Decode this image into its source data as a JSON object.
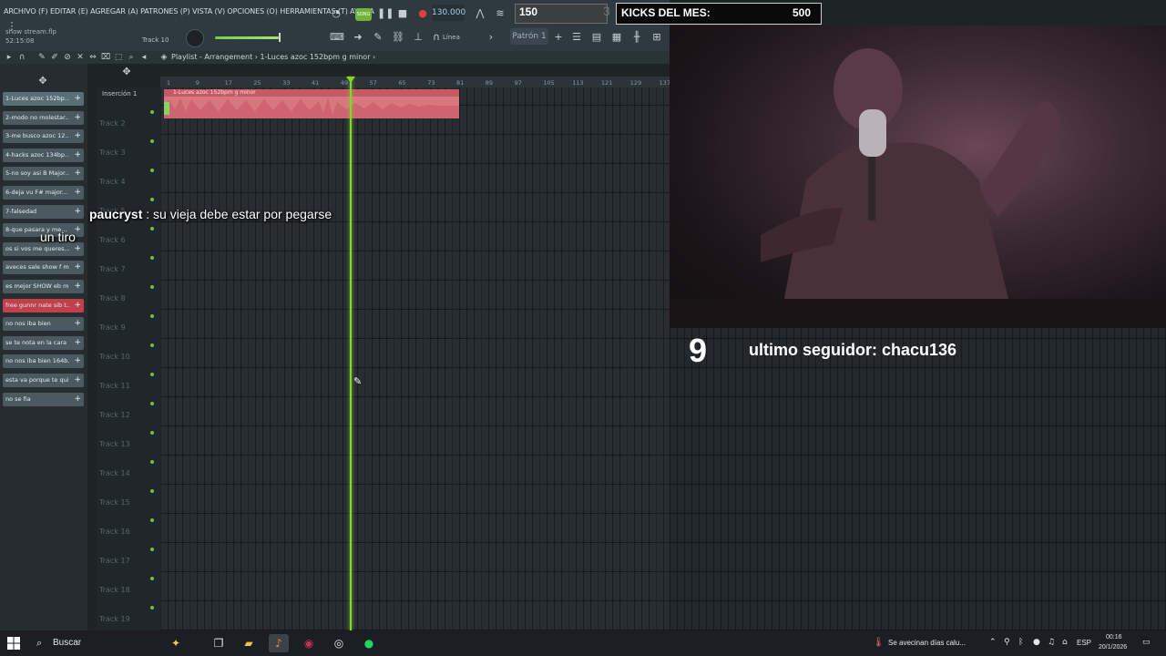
{
  "menu": "ARCHIVO (F) EDITAR (E) AGREGAR (A) PATRONES (P) VISTA (V) OPCIONES (O) HERRAMIENTAS (T) AYUDA",
  "project": {
    "name": "show stream.flp",
    "time": "52:15:08"
  },
  "transport": {
    "song_badge": "SONG",
    "tempo": "130.000"
  },
  "mixer_track": "Track 10",
  "line_mode": "Línea",
  "pattern": "Patrón 1",
  "hud": {
    "counter": "150",
    "ghost": "3",
    "kicks_label": "KICKS DEL MES:",
    "kicks_value": "500"
  },
  "breadcrumb": "Playlist - Arrangement  ›  1-Luces azoc 152bpm g minor  ›",
  "insert_label": "Inserción 1",
  "clip": {
    "title": "1-Luces azoc 152bpm g minor"
  },
  "ruler": [
    "1",
    "9",
    "17",
    "25",
    "33",
    "41",
    "49",
    "57",
    "65",
    "73",
    "81",
    "89",
    "97",
    "105",
    "113",
    "121",
    "129",
    "137"
  ],
  "tracks": [
    "Track 2",
    "Track 3",
    "Track 4",
    "Track 5",
    "Track 6",
    "Track 7",
    "Track 8",
    "Track 9",
    "Track 10",
    "Track 11",
    "Track 12",
    "Track 13",
    "Track 14",
    "Track 15",
    "Track 16",
    "Track 17",
    "Track 18",
    "Track 19"
  ],
  "channels": [
    {
      "label": "1-Luces azoc 152bp...",
      "color": "#5a6e77"
    },
    {
      "label": "2-modo no molestar...",
      "color": "#4b5a61"
    },
    {
      "label": "3-me busco azoc 12...",
      "color": "#4b5a61"
    },
    {
      "label": "4-hacks azoc 134bp...",
      "color": "#4b5a61"
    },
    {
      "label": "5-no soy asi  B Major...",
      "color": "#4b5a61"
    },
    {
      "label": "6-deja vu  F# major...",
      "color": "#4b5a61"
    },
    {
      "label": "7-falsedad",
      "color": "#4b5a61"
    },
    {
      "label": "8-que pasara y me...",
      "color": "#4b5a61"
    },
    {
      "label": "os si vos me queres...",
      "color": "#4b5a61"
    },
    {
      "label": "aveces sale show f m...",
      "color": "#4b5a61"
    },
    {
      "label": "es mejor SHOW eb mi...",
      "color": "#4b5a61"
    },
    {
      "label": "free gunnr  nate sib t...",
      "color": "#c0404c"
    },
    {
      "label": "no nos iba bien",
      "color": "#4b5a61"
    },
    {
      "label": "se te nota en la cara",
      "color": "#4b5a61"
    },
    {
      "label": "no nos iba bien 164b...",
      "color": "#4b5a61"
    },
    {
      "label": "esta va porque te qui...",
      "color": "#4b5a61"
    },
    {
      "label": "no se fia",
      "color": "#4b5a61"
    }
  ],
  "chat": {
    "user": "paucryst",
    "message": " : su vieja debe estar por pegarse",
    "continuation": "un tiro"
  },
  "follower": {
    "number": "9",
    "text": "ultimo seguidor: chacu136"
  },
  "taskbar": {
    "search": "Buscar",
    "weather": "Se avecinan días calu...",
    "lang": "ESP",
    "time": "00:16",
    "date": "20/1/2026"
  },
  "colors": {
    "playhead": "#84d62f",
    "clip": "#d9777f",
    "accent_green": "#6cc24a"
  }
}
